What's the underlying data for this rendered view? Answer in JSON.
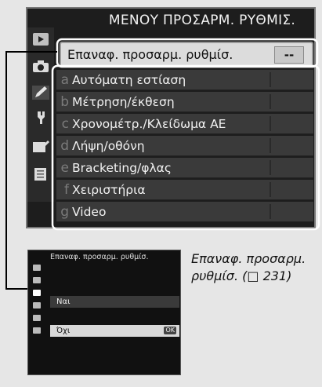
{
  "menu": {
    "title": "ΜΕΝΟΥ ΠΡΟΣΑΡΜ. ΡΥΘΜΙΣ.",
    "selected_item": {
      "label": "Επαναφ. προσαρμ. ρυθμίσ.",
      "value": "--"
    },
    "items": [
      {
        "letter": "a",
        "label": "Αυτόματη εστίαση"
      },
      {
        "letter": "b",
        "label": "Μέτρηση/έκθεση"
      },
      {
        "letter": "c",
        "label": "Χρονομέτρ./Κλείδωμα AE"
      },
      {
        "letter": "d",
        "label": "Λήψη/οθόνη"
      },
      {
        "letter": "e",
        "label": "Bracketing/φλας"
      },
      {
        "letter": "f",
        "label": "Χειριστήρια"
      },
      {
        "letter": "g",
        "label": "Video"
      }
    ],
    "side_tabs": [
      "playback-icon",
      "camera-icon",
      "pencil-icon",
      "wrench-icon",
      "retouch-icon",
      "my-menu-icon"
    ]
  },
  "inset": {
    "title": "Επαναφ. προσαρμ. ρυθμίσ.",
    "option_yes": "Ναι",
    "option_no": "Όχι",
    "ok_badge": "OK"
  },
  "caption": {
    "text": "Επαναφ. προσαρμ. ρυθμίσ.",
    "reference": "(□ 231)"
  },
  "colors": {
    "screen_bg": "#1d1d1d",
    "highlight": "#dcdcdc",
    "item_bg": "#3a3a3a",
    "callout_outline": "#ffffff"
  }
}
